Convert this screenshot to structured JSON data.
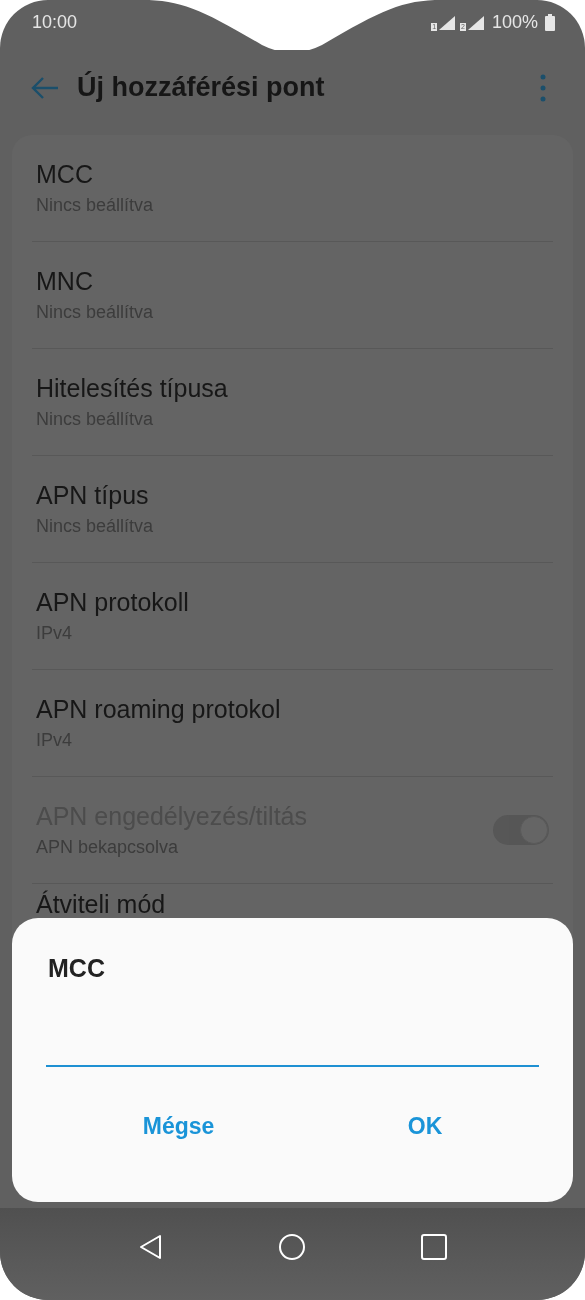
{
  "status_bar": {
    "time": "10:00",
    "sim1": "1",
    "sim2": "2",
    "battery": "100%"
  },
  "toolbar": {
    "title": "Új hozzáférési pont"
  },
  "settings": [
    {
      "kind": "text",
      "title": "MCC",
      "summary": "Nincs beállítva"
    },
    {
      "kind": "text",
      "title": "MNC",
      "summary": "Nincs beállítva"
    },
    {
      "kind": "text",
      "title": "Hitelesítés típusa",
      "summary": "Nincs beállítva"
    },
    {
      "kind": "text",
      "title": "APN típus",
      "summary": "Nincs beállítva"
    },
    {
      "kind": "text",
      "title": "APN protokoll",
      "summary": "IPv4"
    },
    {
      "kind": "text",
      "title": "APN roaming protokol",
      "summary": "IPv4"
    },
    {
      "kind": "toggle",
      "title": "APN engedélyezés/tiltás",
      "summary": "APN bekapcsolva",
      "disabled": true,
      "on": true
    },
    {
      "kind": "text",
      "title": "Átviteli mód"
    }
  ],
  "dialog": {
    "title": "MCC",
    "buttons": [
      "Mégse",
      "OK"
    ]
  }
}
